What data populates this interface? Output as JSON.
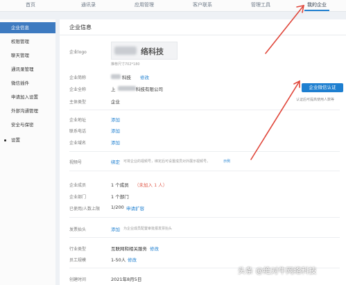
{
  "topnav": {
    "tabs": [
      {
        "label": "首页"
      },
      {
        "label": "通讯录"
      },
      {
        "label": "应用管理"
      },
      {
        "label": "客户联系"
      },
      {
        "label": "管理工具"
      },
      {
        "label": "我的企业"
      }
    ],
    "active_tab": "我的企业"
  },
  "sidebar": {
    "items": [
      {
        "label": "企业信息",
        "active": true
      },
      {
        "label": "权限管理"
      },
      {
        "label": "聊天管理"
      },
      {
        "label": "通讯录管理"
      },
      {
        "label": "微信插件"
      },
      {
        "label": "申请加入设置"
      },
      {
        "label": "外部沟通管理"
      },
      {
        "label": "安全与保密"
      },
      {
        "label": "设置"
      }
    ]
  },
  "main": {
    "title": "企业信息",
    "logo": {
      "label": "企业logo",
      "text": "络科技",
      "size_hint": "推荐尺寸702*180"
    },
    "short_name": {
      "label": "企业简称",
      "value": "科技",
      "edit": "修改"
    },
    "full_name": {
      "label": "企业全称",
      "value_prefix": "上",
      "value_suffix": "科技有限公司"
    },
    "verify_button": "企业微信认证",
    "verify_note": "认证后可提高使用人数等",
    "subject_type": {
      "label": "主体类型",
      "value": "企业"
    },
    "address": {
      "label": "企业地址",
      "action": "添加"
    },
    "phone": {
      "label": "联系电话",
      "action": "添加"
    },
    "domain": {
      "label": "企业域名",
      "action": "添加"
    },
    "video_account": {
      "label": "视频号",
      "action": "绑定",
      "hint": "可将企业的视频号，绑定后可设置成员对外展示视频号。",
      "example": "示例"
    },
    "members": {
      "label": "企业成员",
      "value": "1 个成员",
      "note": "（未加入 1 人）"
    },
    "departments": {
      "label": "企业部门",
      "value": "1 个部门"
    },
    "limit": {
      "label": "已使用/人数上限",
      "value": "1/200",
      "action": "申请扩容"
    },
    "invoice": {
      "label": "发票抬头",
      "action": "添加",
      "hint": "为企业成员配置审批报发票抬头"
    },
    "industry": {
      "label": "行业类型",
      "value": "互联网和相关服务",
      "edit": "修改"
    },
    "scale": {
      "label": "员工规模",
      "value": "1-50人",
      "edit": "修改"
    },
    "created": {
      "label": "创建时间",
      "value": "2021年8月5日"
    }
  },
  "watermark": "头条 @绝对牛网络科技",
  "colors": {
    "accent": "#1e7fd0",
    "sidebar_active": "#3d7ac0",
    "arrow": "#e0463a",
    "warning": "#e05a4a"
  }
}
